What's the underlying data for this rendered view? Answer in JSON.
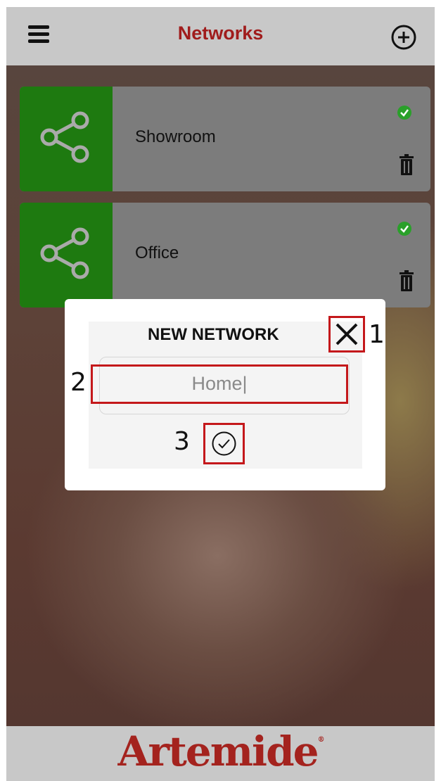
{
  "header": {
    "title": "Networks",
    "menu_icon": "hamburger-menu-icon",
    "add_icon": "add-circle-icon"
  },
  "networks": [
    {
      "name": "Showroom",
      "status": "connected",
      "icon": "share-icon"
    },
    {
      "name": "Office",
      "status": "connected",
      "icon": "share-icon"
    }
  ],
  "dialog": {
    "title": "NEW NETWORK",
    "input_value": "Home|",
    "markers": [
      "1",
      "2",
      "3"
    ],
    "close_icon": "close-icon",
    "confirm_icon": "check-circle-icon"
  },
  "footer": {
    "brand": "Artemide",
    "registered": "®"
  },
  "colors": {
    "brand": "#a01c1c",
    "card_icon_bg": "#1e7a10",
    "highlight": "#c4181b",
    "status_ok": "#2aa02a"
  }
}
